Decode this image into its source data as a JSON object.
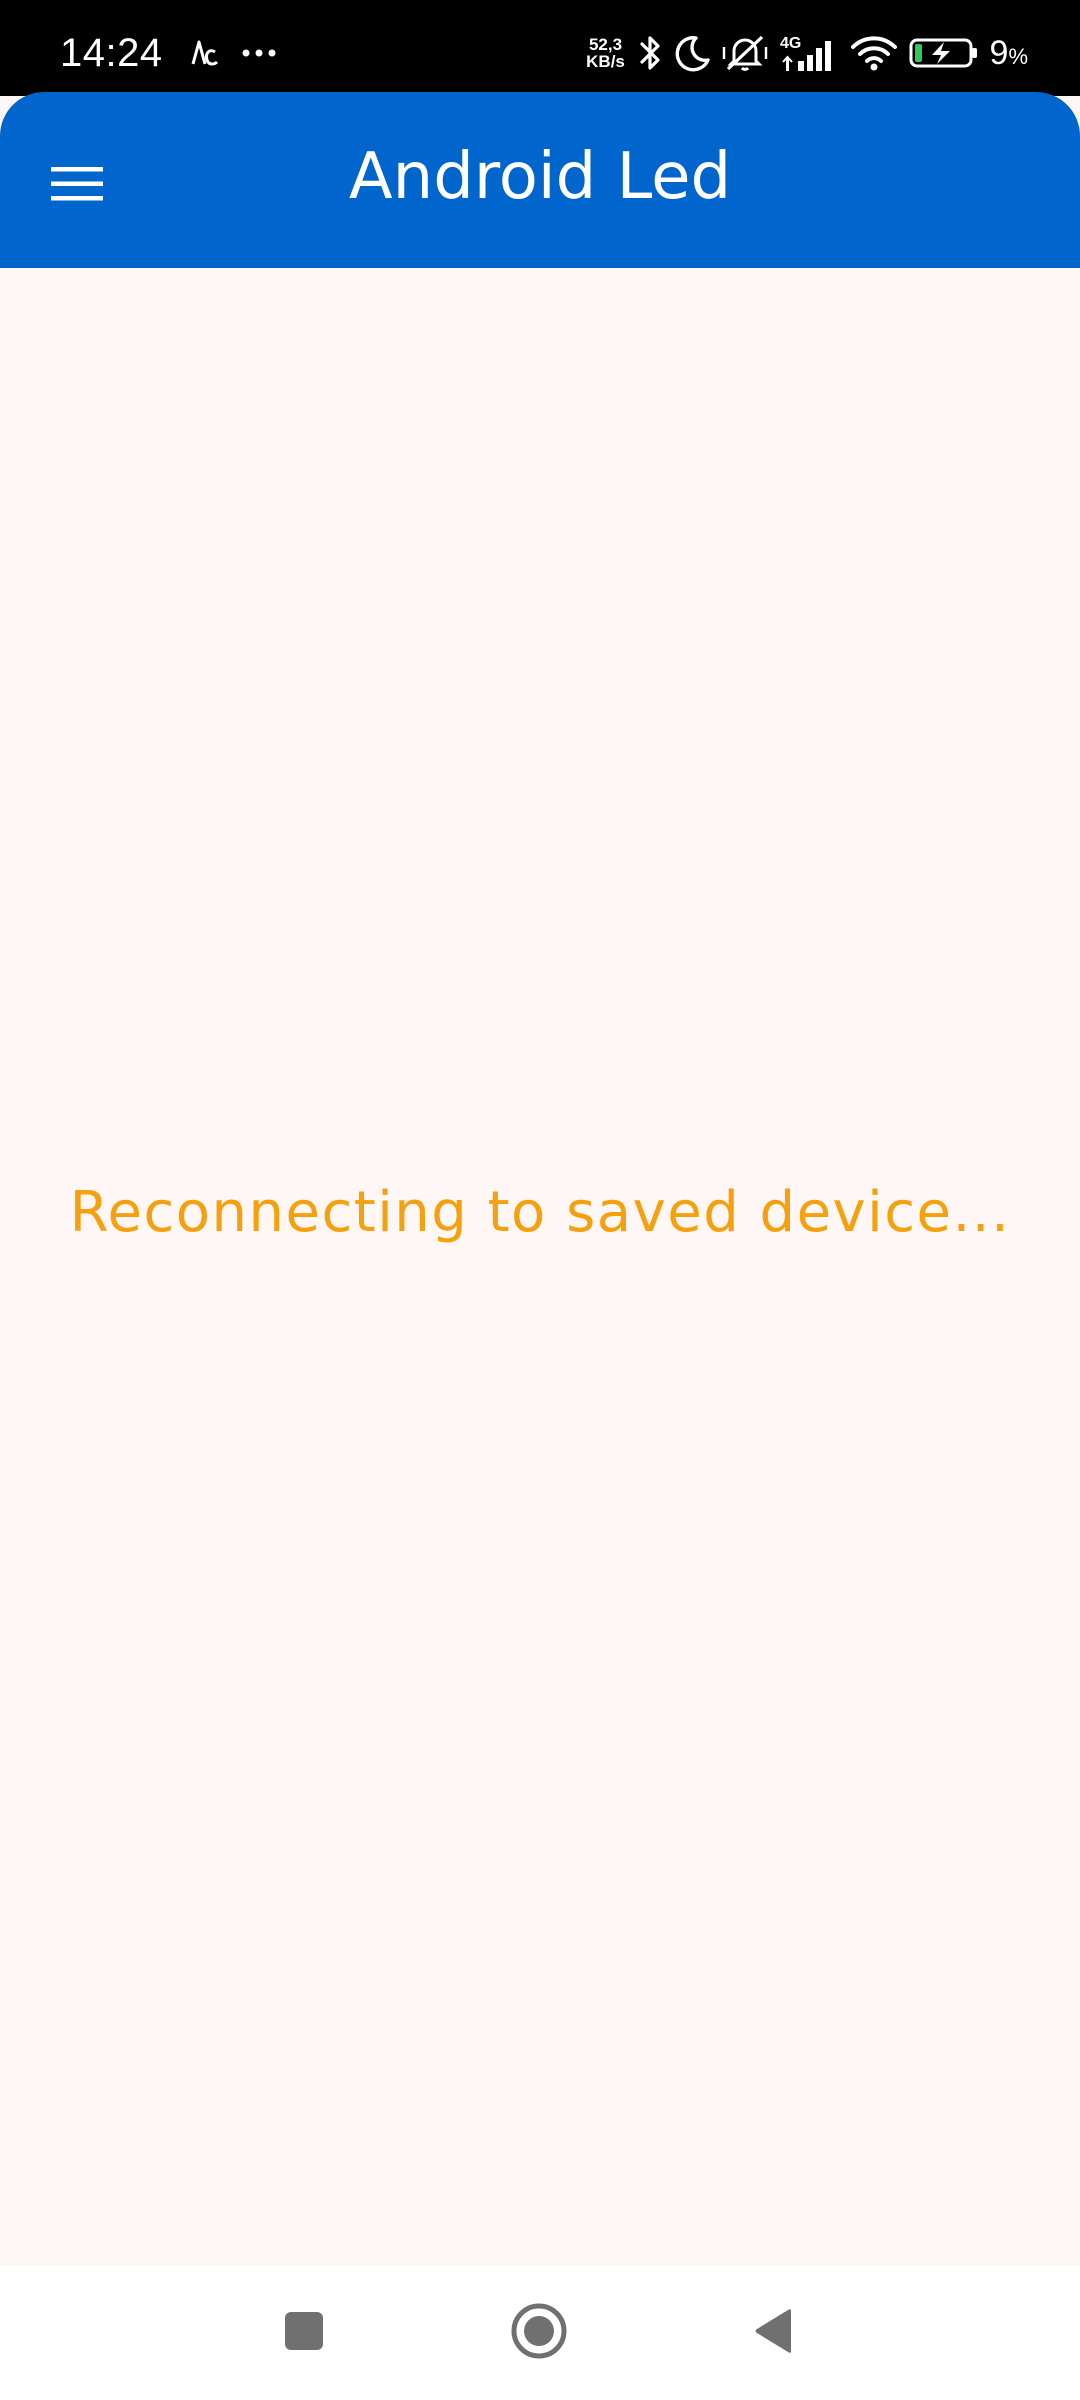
{
  "status_bar": {
    "time": "14:24",
    "net_speed_value": "52,3",
    "net_speed_unit": "KB/s",
    "network_type": "4G",
    "battery_level": "9",
    "battery_unit": "%"
  },
  "app_bar": {
    "title": "Android Led",
    "menu_icon": "hamburger-menu-icon"
  },
  "main": {
    "status_message": "Reconnecting to saved device..."
  },
  "navigation_bar": {
    "recents_icon": "square-icon",
    "home_icon": "circle-icon",
    "back_icon": "triangle-back-icon"
  },
  "colors": {
    "app_bar": "#0065cc",
    "background": "#fff7f6",
    "status_message": "#f5a00e"
  }
}
